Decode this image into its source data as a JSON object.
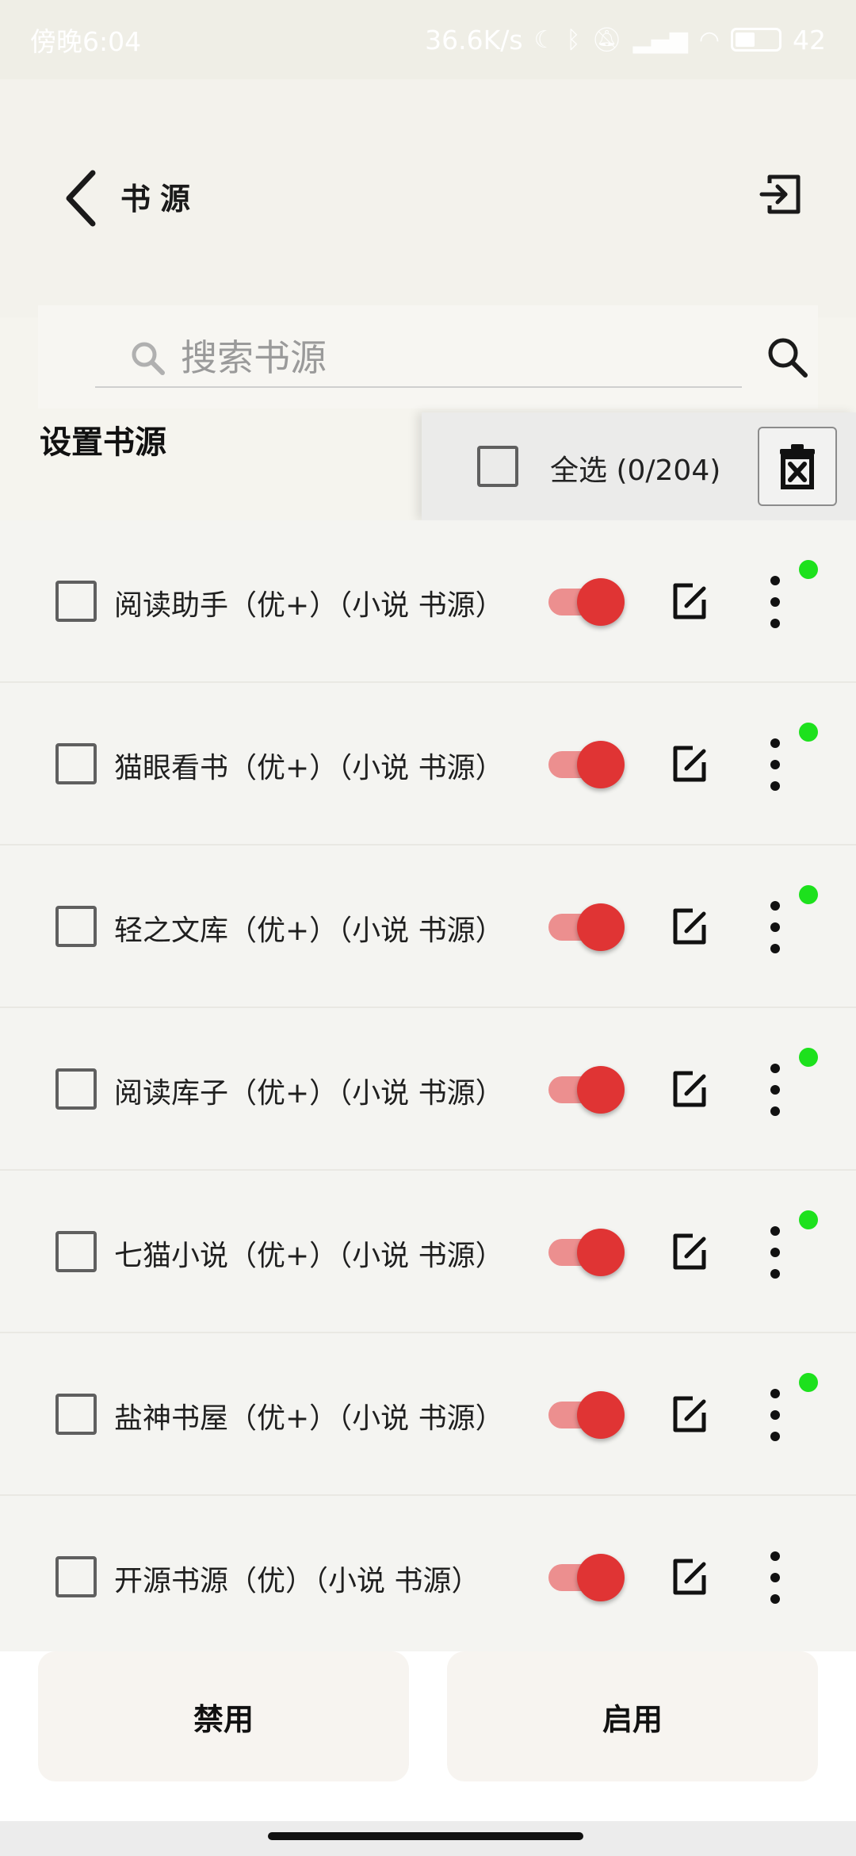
{
  "status_bar": {
    "time": "傍晚6:04",
    "net_speed": "36.6K/s",
    "battery": "42",
    "battery_level": 0.42
  },
  "header": {
    "title": "书源",
    "back_icon": "chevron-left-icon",
    "import_icon": "import-icon"
  },
  "search": {
    "placeholder": "搜索书源",
    "value": ""
  },
  "group": {
    "label": "设置书源"
  },
  "selection": {
    "select_all_label": "全选 (0/204)",
    "selected": 0,
    "total": 204,
    "delete_icon": "delete-selection-icon"
  },
  "sources": [
    {
      "name": "阅读助手（优+）（小说 书源）",
      "enabled": true,
      "checked": false,
      "status_dot": true
    },
    {
      "name": "猫眼看书（优+）（小说 书源）",
      "enabled": true,
      "checked": false,
      "status_dot": true
    },
    {
      "name": "轻之文库（优+）（小说 书源）",
      "enabled": true,
      "checked": false,
      "status_dot": true
    },
    {
      "name": "阅读库子（优+）（小说 书源）",
      "enabled": true,
      "checked": false,
      "status_dot": true
    },
    {
      "name": "七猫小说（优+）（小说 书源）",
      "enabled": true,
      "checked": false,
      "status_dot": true
    },
    {
      "name": "盐神书屋（优+）（小说 书源）",
      "enabled": true,
      "checked": false,
      "status_dot": true
    },
    {
      "name": "开源书源（优）（小说 书源）",
      "enabled": true,
      "checked": false,
      "status_dot": false
    }
  ],
  "actions": {
    "disable_label": "禁用",
    "enable_label": "启用"
  },
  "colors": {
    "accent": "#e03434",
    "track": "#ec8f8f",
    "status_ok": "#1de11d"
  }
}
